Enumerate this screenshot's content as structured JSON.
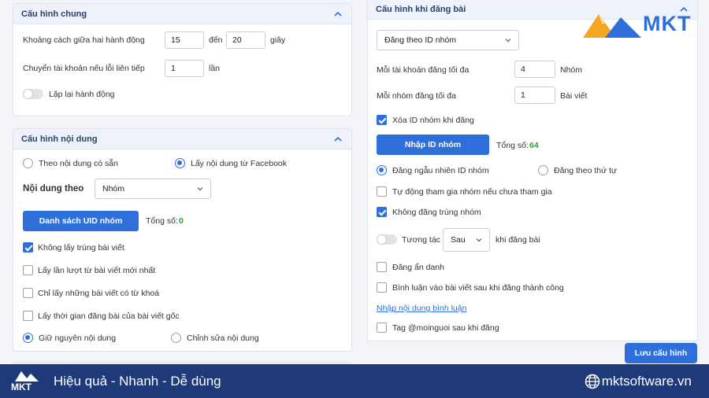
{
  "general": {
    "title": "Cấu hình chung",
    "delay_label": "Khoảng cách giữa hai hành động",
    "delay_from": "15",
    "delay_to_label": "đến",
    "delay_to": "20",
    "delay_unit": "giây",
    "switch_label": "Chuyển tài khoản nếu lỗi liên tiếp",
    "switch_value": "1",
    "switch_unit": "lần",
    "repeat_label": "Lặp lại hành động"
  },
  "content": {
    "title": "Cấu hình nội dung",
    "radio_available": "Theo nội dung có sẵn",
    "radio_facebook": "Lấy nội dung từ Facebook",
    "content_by_label": "Nội dung theo",
    "content_by_value": "Nhóm",
    "uid_button": "Danh sách UID nhóm",
    "total_label": "Tổng số:",
    "total_value": "0",
    "opt_no_dup": "Không lấy trùng bài viết",
    "opt_latest": "Lấy lần lượt từ bài viết mới nhất",
    "opt_keyword": "Chỉ lấy những bài viết có từ khoá",
    "opt_time": "Lấy thời gian đăng bài của bài viết gốc",
    "radio_keep": "Giữ nguyên nội dung",
    "radio_edit": "Chỉnh sửa nội dung"
  },
  "posting": {
    "title": "Cấu hình khi đăng bài",
    "mode_value": "Đăng theo ID nhóm",
    "max_per_account_label": "Mỗi tài khoản đăng tối đa",
    "max_per_account_value": "4",
    "max_per_account_unit": "Nhóm",
    "max_per_group_label": "Mỗi nhóm đăng tối đa",
    "max_per_group_value": "1",
    "max_per_group_unit": "Bài viết",
    "delete_id_label": "Xóa ID nhóm khi đăng",
    "import_button": "Nhập ID nhóm",
    "total_label": "Tổng số:",
    "total_value": "64",
    "radio_random": "Đăng ngẫu nhiên ID nhóm",
    "radio_order": "Đăng theo thứ tự",
    "auto_join_label": "Tự động tham gia nhóm nếu chưa tham gia",
    "no_dup_group_label": "Không đăng trùng nhóm",
    "interact_label": "Tương tác",
    "interact_when": "Sau",
    "interact_suffix": "khi đăng bài",
    "anonymous_label": "Đăng ẩn danh",
    "comment_label": "Bình luận vào bài viết sau khi đăng thành công",
    "comment_link": "Nhập nội dung bình luận",
    "tag_label": "Tag @moinguoi sau khi đăng",
    "save_button": "Lưu cấu hình"
  },
  "brand": {
    "logo_text": "MKT",
    "slogan": "Hiệu quả - Nhanh - Dễ dùng",
    "website": "mktsoftware.vn",
    "accent": "#2f6fdc",
    "footer_bg": "#1e3a78",
    "logo_orange": "#f5a623"
  }
}
